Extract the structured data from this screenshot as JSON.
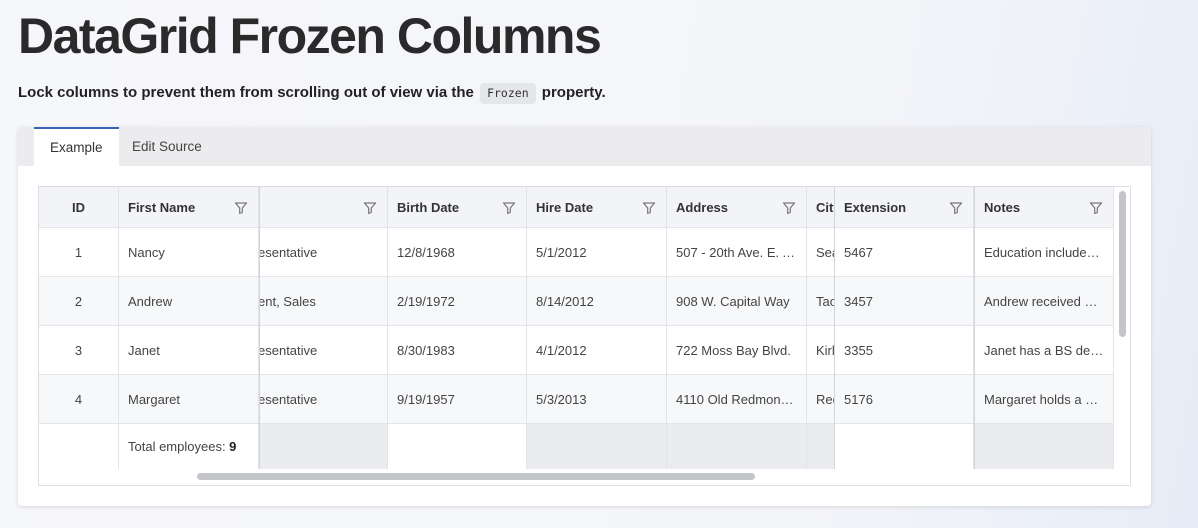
{
  "title": {
    "part1": "DataGrid",
    "part2": "Frozen Columns"
  },
  "description": {
    "before": "Lock columns to prevent them from scrolling out of view via the",
    "code": "Frozen",
    "after": "property."
  },
  "tabs": [
    {
      "label": "Example",
      "active": true
    },
    {
      "label": "Edit Source",
      "active": false
    }
  ],
  "grid": {
    "columns": {
      "id": "ID",
      "first_name": "First Name",
      "title": "",
      "birth_date": "Birth Date",
      "hire_date": "Hire Date",
      "address": "Address",
      "city": "City",
      "extension": "Extension",
      "notes": "Notes"
    },
    "rows": [
      {
        "id": "1",
        "first_name": "Nancy",
        "title": "esentative",
        "birth_date": "12/8/1968",
        "hire_date": "5/1/2012",
        "address": "507 - 20th Ave. E. A…",
        "city": "Sea",
        "extension": "5467",
        "notes": "Education include…"
      },
      {
        "id": "2",
        "first_name": "Andrew",
        "title": "ent, Sales",
        "birth_date": "2/19/1972",
        "hire_date": "8/14/2012",
        "address": "908 W. Capital Way",
        "city": "Tac",
        "extension": "3457",
        "notes": "Andrew received h…"
      },
      {
        "id": "3",
        "first_name": "Janet",
        "title": "esentative",
        "birth_date": "8/30/1983",
        "hire_date": "4/1/2012",
        "address": "722 Moss Bay Blvd.",
        "city": "Kirl",
        "extension": "3355",
        "notes": "Janet has a BS deg…"
      },
      {
        "id": "4",
        "first_name": "Margaret",
        "title": "esentative",
        "birth_date": "9/19/1957",
        "hire_date": "5/3/2013",
        "address": "4110 Old Redmon…",
        "city": "Rec",
        "extension": "5176",
        "notes": "Margaret holds a B…"
      }
    ],
    "footer": {
      "label": "Total employees:",
      "count": "9"
    },
    "icons": {
      "filter": "filter-icon"
    }
  }
}
